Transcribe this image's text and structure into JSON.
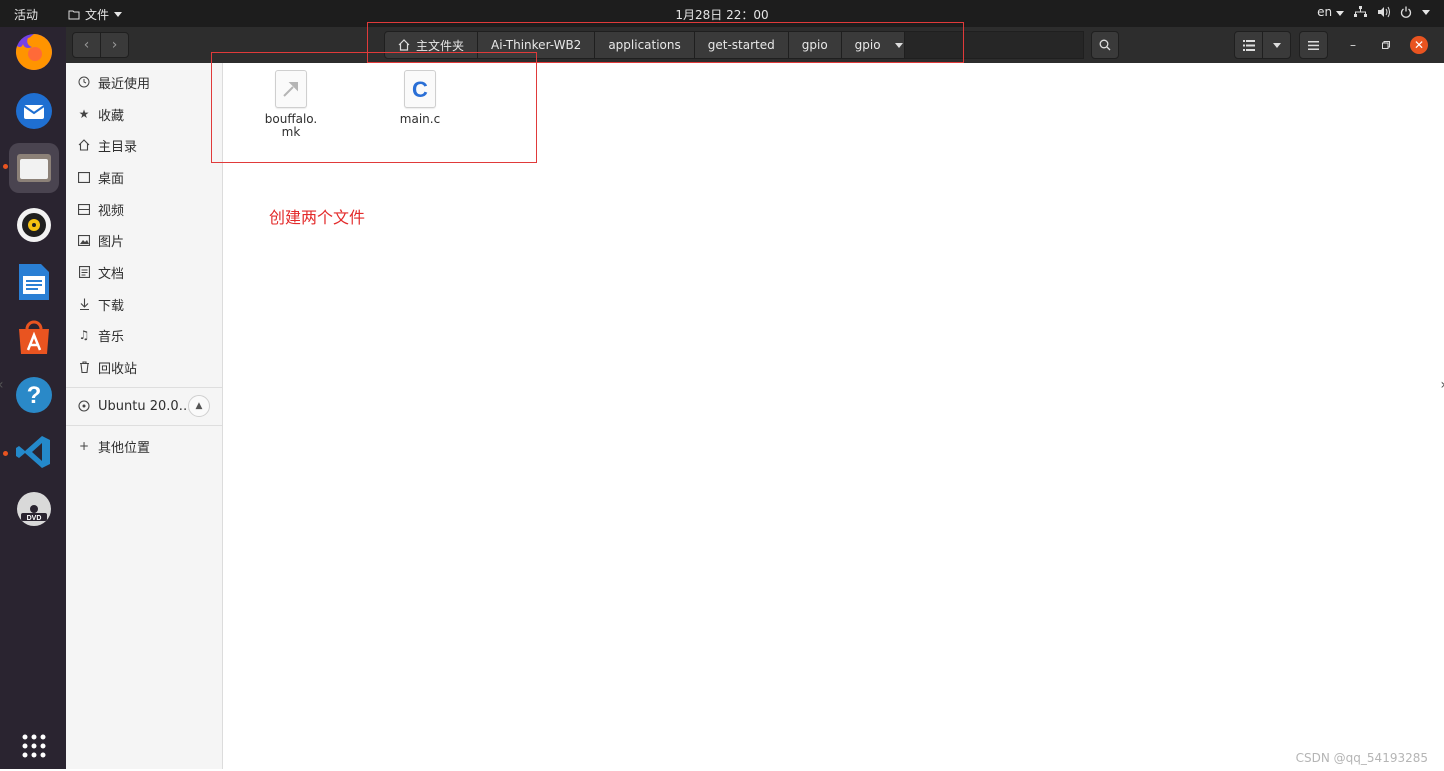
{
  "topbar": {
    "activities": "活动",
    "app_menu": "文件",
    "clock": "1月28日  22：00",
    "input_method": "en"
  },
  "dock": {
    "apps": [
      "firefox-icon",
      "thunderbird-icon",
      "files-icon",
      "rhythmbox-icon",
      "writer-icon",
      "software-icon",
      "help-icon",
      "vscode-icon",
      "dvd-icon"
    ],
    "show_apps": "show-apps-icon"
  },
  "header": {
    "path": [
      "主文件夹",
      "Ai-Thinker-WB2",
      "applications",
      "get-started",
      "gpio",
      "gpio"
    ]
  },
  "sidebar": {
    "items": [
      {
        "label": "最近使用",
        "icon": "clock-icon"
      },
      {
        "label": "收藏",
        "icon": "star-icon"
      },
      {
        "label": "主目录",
        "icon": "home-icon"
      },
      {
        "label": "桌面",
        "icon": "desktop-icon"
      },
      {
        "label": "视频",
        "icon": "video-icon"
      },
      {
        "label": "图片",
        "icon": "picture-icon"
      },
      {
        "label": "文档",
        "icon": "document-icon"
      },
      {
        "label": "下载",
        "icon": "download-icon"
      },
      {
        "label": "音乐",
        "icon": "music-icon"
      },
      {
        "label": "回收站",
        "icon": "trash-icon"
      }
    ],
    "device": "Ubuntu 20.0…",
    "other_locations": "其他位置"
  },
  "files": [
    {
      "name_line1": "bouffalo.",
      "name_line2": "mk"
    },
    {
      "name_line1": "main.c",
      "name_line2": ""
    }
  ],
  "annotation": "创建两个文件",
  "watermark": "CSDN @qq_54193285",
  "colors": {
    "accent": "#e95420",
    "annotation": "#e03a3a",
    "vscode": "#2489ca"
  }
}
